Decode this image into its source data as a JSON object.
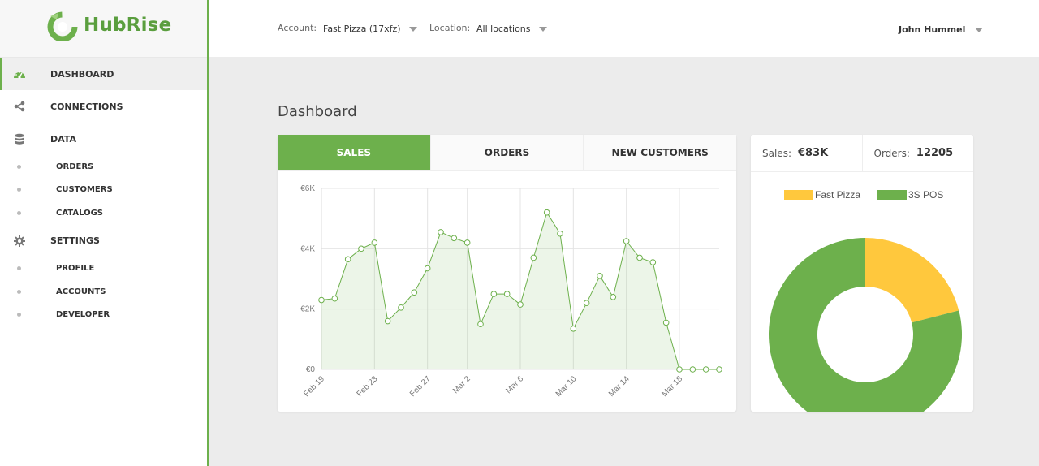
{
  "app": {
    "name": "HubRise"
  },
  "colors": {
    "brand": "#6db04c",
    "fast_pizza": "#ffc83d",
    "pos": "#6db04c"
  },
  "sidebar": {
    "items": [
      {
        "label": "DASHBOARD",
        "icon": "dashboard-icon",
        "active": true
      },
      {
        "label": "CONNECTIONS",
        "icon": "share-icon"
      },
      {
        "label": "DATA",
        "icon": "database-icon"
      }
    ],
    "data_sub": [
      "ORDERS",
      "CUSTOMERS",
      "CATALOGS"
    ],
    "settings": {
      "label": "SETTINGS",
      "icon": "gear-icon"
    },
    "settings_sub": [
      "PROFILE",
      "ACCOUNTS",
      "DEVELOPER"
    ]
  },
  "topbar": {
    "account_label": "Account:",
    "account_value": "Fast Pizza (17xfz)",
    "location_label": "Location:",
    "location_value": "All locations",
    "user_name": "John Hummel"
  },
  "main": {
    "title": "Dashboard",
    "tabs": [
      "SALES",
      "ORDERS",
      "NEW CUSTOMERS"
    ],
    "active_tab": "SALES"
  },
  "stats": {
    "sales_label": "Sales:",
    "sales_value": "€83K",
    "orders_label": "Orders:",
    "orders_value": "12205"
  },
  "chart_data": [
    {
      "type": "area",
      "x": [
        "Feb 19",
        "Feb 20",
        "Feb 21",
        "Feb 22",
        "Feb 23",
        "Feb 24",
        "Feb 25",
        "Feb 26",
        "Feb 27",
        "Feb 28",
        "Mar 1",
        "Mar 2",
        "Mar 3",
        "Mar 4",
        "Mar 5",
        "Mar 6",
        "Mar 7",
        "Mar 8",
        "Mar 9",
        "Mar 10",
        "Mar 11",
        "Mar 12",
        "Mar 13",
        "Mar 14",
        "Mar 15",
        "Mar 16",
        "Mar 17",
        "Mar 18",
        "Mar 19",
        "Mar 20",
        "Mar 21"
      ],
      "values": [
        2300,
        2350,
        3650,
        4000,
        4200,
        1600,
        2050,
        2550,
        3350,
        4550,
        4350,
        4200,
        1500,
        2500,
        2500,
        2150,
        3700,
        5200,
        4500,
        1350,
        2200,
        3100,
        2400,
        4250,
        3700,
        3550,
        1550,
        0,
        0,
        0,
        0
      ],
      "x_tick_labels": [
        "Feb 19",
        "Feb 23",
        "Feb 27",
        "Mar 2",
        "Mar 6",
        "Mar 10",
        "Mar 14",
        "Mar 18"
      ],
      "y_tick_labels": [
        "€0",
        "€2K",
        "€4K",
        "€6K"
      ],
      "ylim": [
        0,
        6000
      ],
      "grid": true,
      "color": "#6db04c"
    },
    {
      "type": "pie",
      "legend_position": "top",
      "series": [
        {
          "name": "Fast Pizza",
          "value": 21,
          "color": "#ffc83d"
        },
        {
          "name": "3S POS",
          "value": 79,
          "color": "#6db04c"
        }
      ]
    }
  ]
}
